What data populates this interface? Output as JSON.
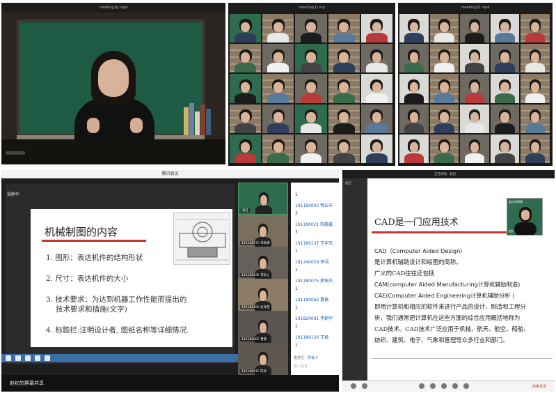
{
  "panel_teacher": {
    "title": "meeting.b[.mp4",
    "books_colors": [
      "#c9b56a",
      "#6d7fa6",
      "#d8d2c0",
      "#8a3c2c",
      "#3f5e7a"
    ]
  },
  "panel_gallery_a": {
    "title": "meeting(1).mp"
  },
  "panel_gallery_b": {
    "title": "meeting(2).mp4"
  },
  "meeting_window": {
    "title": "腾讯会议",
    "sharer_name": "梁静华",
    "screen_share_label": "赵红的屏幕共享",
    "slide": {
      "title": "机械制图的内容",
      "items": [
        "1. 图形：表达机件的结构形状",
        "2. 尺寸：表达机件的大小",
        "3. 技术要求：为达到机器工作性能而提出的",
        "技术要求和措施(文字)",
        "4. 标题栏:注明设计者, 图纸名称等详细情况."
      ]
    },
    "participants": [
      {
        "name": "赵红",
        "active": true
      },
      {
        "name": "191180070 李瑞博",
        "active": false
      },
      {
        "name": "191180035 苏思之",
        "active": false
      },
      {
        "name": "191180166 赵泽茜",
        "active": false
      },
      {
        "name": "191180062 曹建",
        "active": false
      },
      {
        "name": "191180015 陈添",
        "active": false
      }
    ],
    "chat": [
      {
        "text": "1",
        "blue": false
      },
      {
        "text": "191180003 鄂启丰",
        "blue": true
      },
      {
        "text": "3",
        "blue": false
      },
      {
        "text": "191180021 陈鹏鑫",
        "blue": true
      },
      {
        "text": "3",
        "blue": false
      },
      {
        "text": "191180137 于中天",
        "blue": true
      },
      {
        "text": "1",
        "blue": false
      },
      {
        "text": "181240029 李闯",
        "blue": true
      },
      {
        "text": "1",
        "blue": false
      },
      {
        "text": "191180075 廖锐杰",
        "blue": true
      },
      {
        "text": "1",
        "blue": false
      },
      {
        "text": "191180062 曹建",
        "blue": true
      },
      {
        "text": "1",
        "blue": false
      },
      {
        "text": "191820091 李朝宇",
        "blue": true
      },
      {
        "text": "1",
        "blue": false
      },
      {
        "text": "191180126 王颖",
        "blue": true
      },
      {
        "text": "1",
        "blue": false
      }
    ],
    "chat_send_to_label": "发送至：",
    "chat_send_to_value": "所有人",
    "chat_input_placeholder": "输入信息..."
  },
  "cad_window": {
    "title": "正在讲话：赵红",
    "sidebar_label": "赵红",
    "pip_label": "赵红的视频",
    "pip_name": "赵红",
    "end_label": "结束共享",
    "slide": {
      "title": "CAD是一门应用技术",
      "lines": [
        {
          "text": "CAD（Computer Aided Design）",
          "en": true
        },
        {
          "text": "是计算机辅助设计和绘图的简称。",
          "en": false
        },
        {
          "text": "广义的CAD往往还包括",
          "en": false
        },
        {
          "text": "CAM(computer Aided Manufacturing计算机辅助制造)",
          "en": true
        },
        {
          "text": "CAE(Computer Aided Engineering计算机辅助分析 )",
          "en": true
        },
        {
          "text": "即用计算机和相应的软件来进行产品的设计、制造和工程分",
          "en": false
        },
        {
          "text": "析，我们通常把计算机在这些方面的综合应用概括地称为",
          "en": false
        },
        {
          "text": "CAD技术。CAD技术广泛应用于机械、航天、航空、船舶、",
          "en": false
        },
        {
          "text": "纺织、建筑、电子、气象和管理等众多行业和部门。",
          "en": false
        }
      ]
    }
  }
}
